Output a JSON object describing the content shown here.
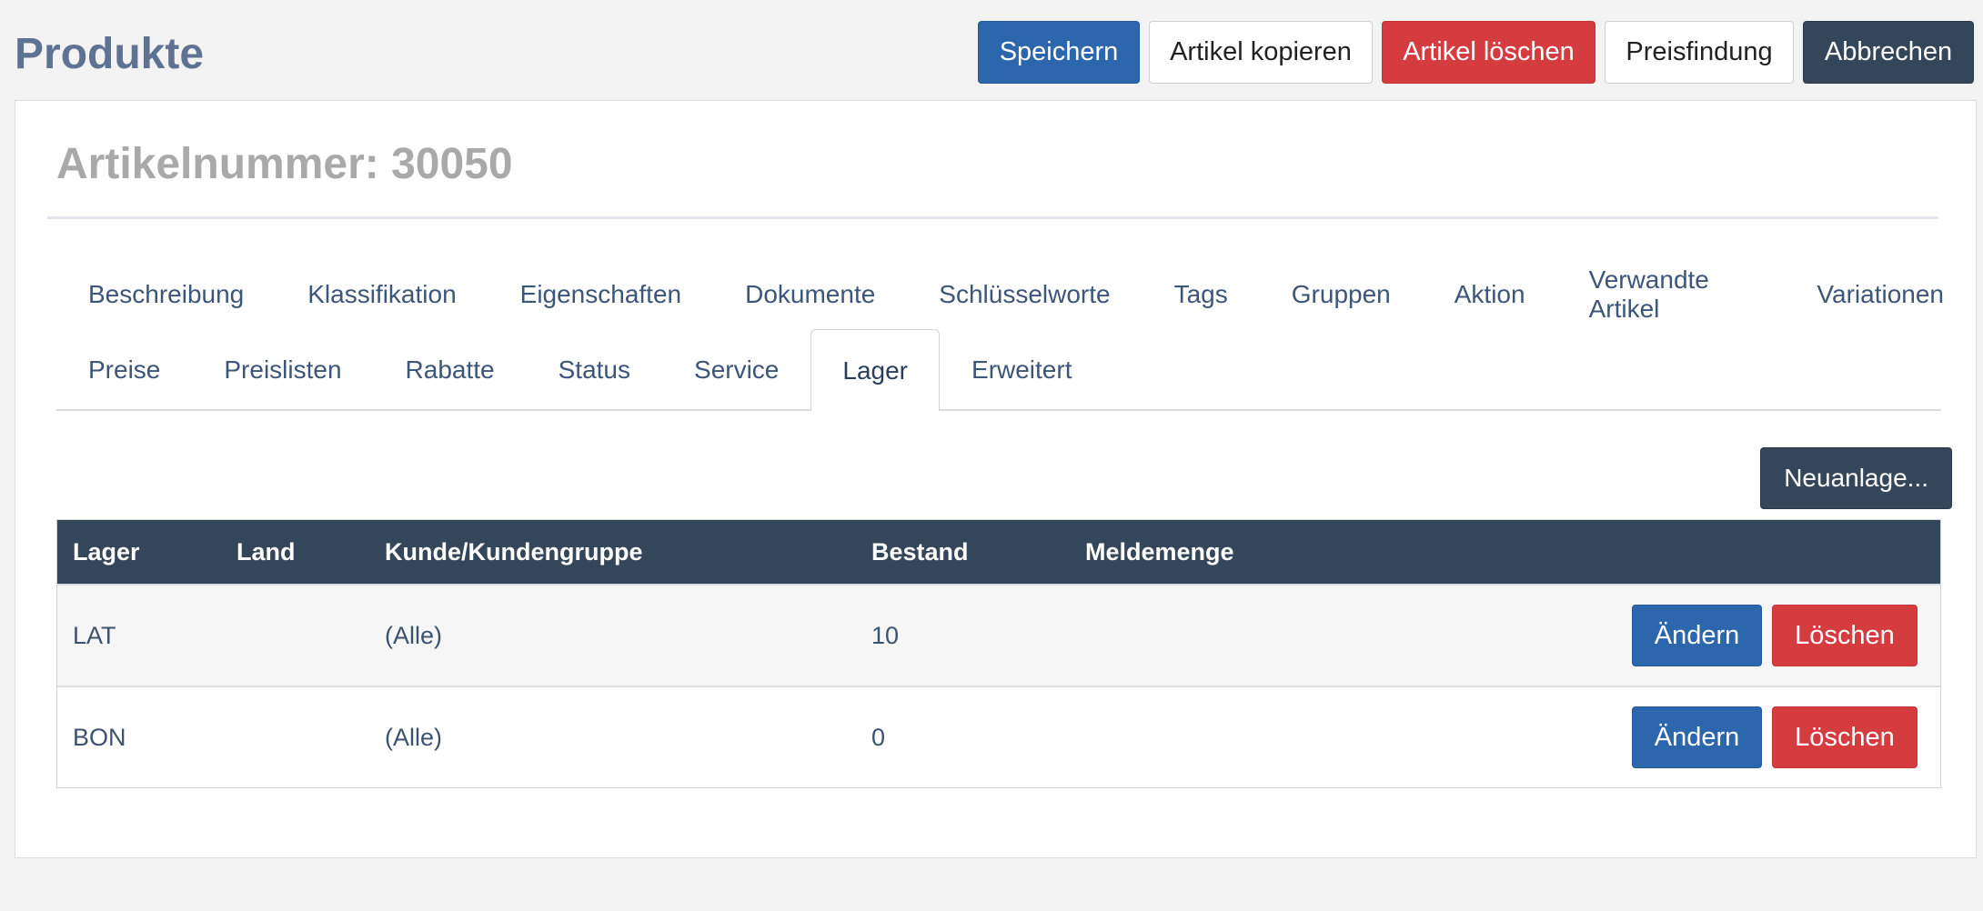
{
  "page_title": "Produkte",
  "toolbar": {
    "save_label": "Speichern",
    "copy_label": "Artikel kopieren",
    "delete_label": "Artikel löschen",
    "pricing_label": "Preisfindung",
    "cancel_label": "Abbrechen"
  },
  "article": {
    "heading": "Artikelnummer: 30050"
  },
  "tabs": {
    "row1": [
      {
        "label": "Beschreibung"
      },
      {
        "label": "Klassifikation"
      },
      {
        "label": "Eigenschaften"
      },
      {
        "label": "Dokumente"
      },
      {
        "label": "Schlüsselworte"
      },
      {
        "label": "Tags"
      },
      {
        "label": "Gruppen"
      },
      {
        "label": "Aktion"
      },
      {
        "label": "Verwandte Artikel"
      },
      {
        "label": "Variationen"
      }
    ],
    "row2": [
      {
        "label": "Preise"
      },
      {
        "label": "Preislisten"
      },
      {
        "label": "Rabatte"
      },
      {
        "label": "Status"
      },
      {
        "label": "Service"
      },
      {
        "label": "Lager",
        "active": true
      },
      {
        "label": "Erweitert"
      }
    ]
  },
  "stock": {
    "new_label": "Neuanlage...",
    "columns": {
      "lager": "Lager",
      "land": "Land",
      "kunde": "Kunde/Kundengruppe",
      "bestand": "Bestand",
      "melde": "Meldemenge"
    },
    "rows": [
      {
        "lager": "LAT",
        "land": "",
        "kunde": "(Alle)",
        "bestand": "10",
        "melde": "",
        "edit_label": "Ändern",
        "delete_label": "Löschen"
      },
      {
        "lager": "BON",
        "land": "",
        "kunde": "(Alle)",
        "bestand": "0",
        "melde": "",
        "edit_label": "Ändern",
        "delete_label": "Löschen"
      }
    ]
  }
}
